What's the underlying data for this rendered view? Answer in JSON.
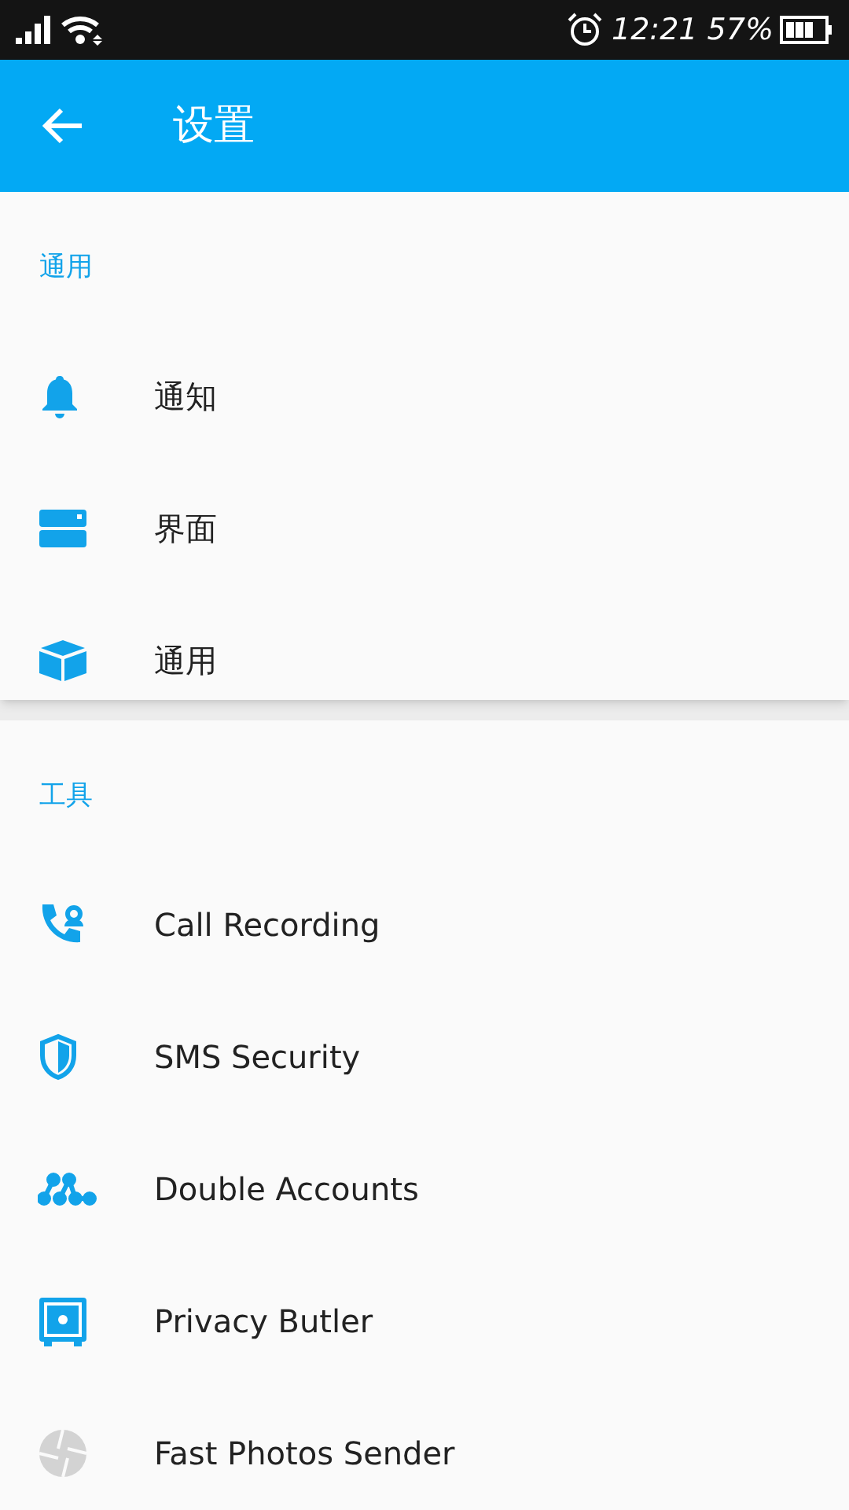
{
  "status_bar": {
    "time": "12:21",
    "battery": "57%"
  },
  "app_bar": {
    "title": "设置"
  },
  "sections": [
    {
      "header": "通用",
      "items": [
        {
          "label": "通知",
          "kind": "bell"
        },
        {
          "label": "界面",
          "kind": "panels"
        },
        {
          "label": "通用",
          "kind": "cube"
        }
      ]
    },
    {
      "header": "工具",
      "items": [
        {
          "label": "Call Recording",
          "kind": "phone"
        },
        {
          "label": "SMS Security",
          "kind": "shield"
        },
        {
          "label": "Double Accounts",
          "kind": "nodes"
        },
        {
          "label": "Privacy Butler",
          "kind": "safe"
        },
        {
          "label": "Fast Photos Sender",
          "kind": "aperture"
        }
      ]
    }
  ]
}
